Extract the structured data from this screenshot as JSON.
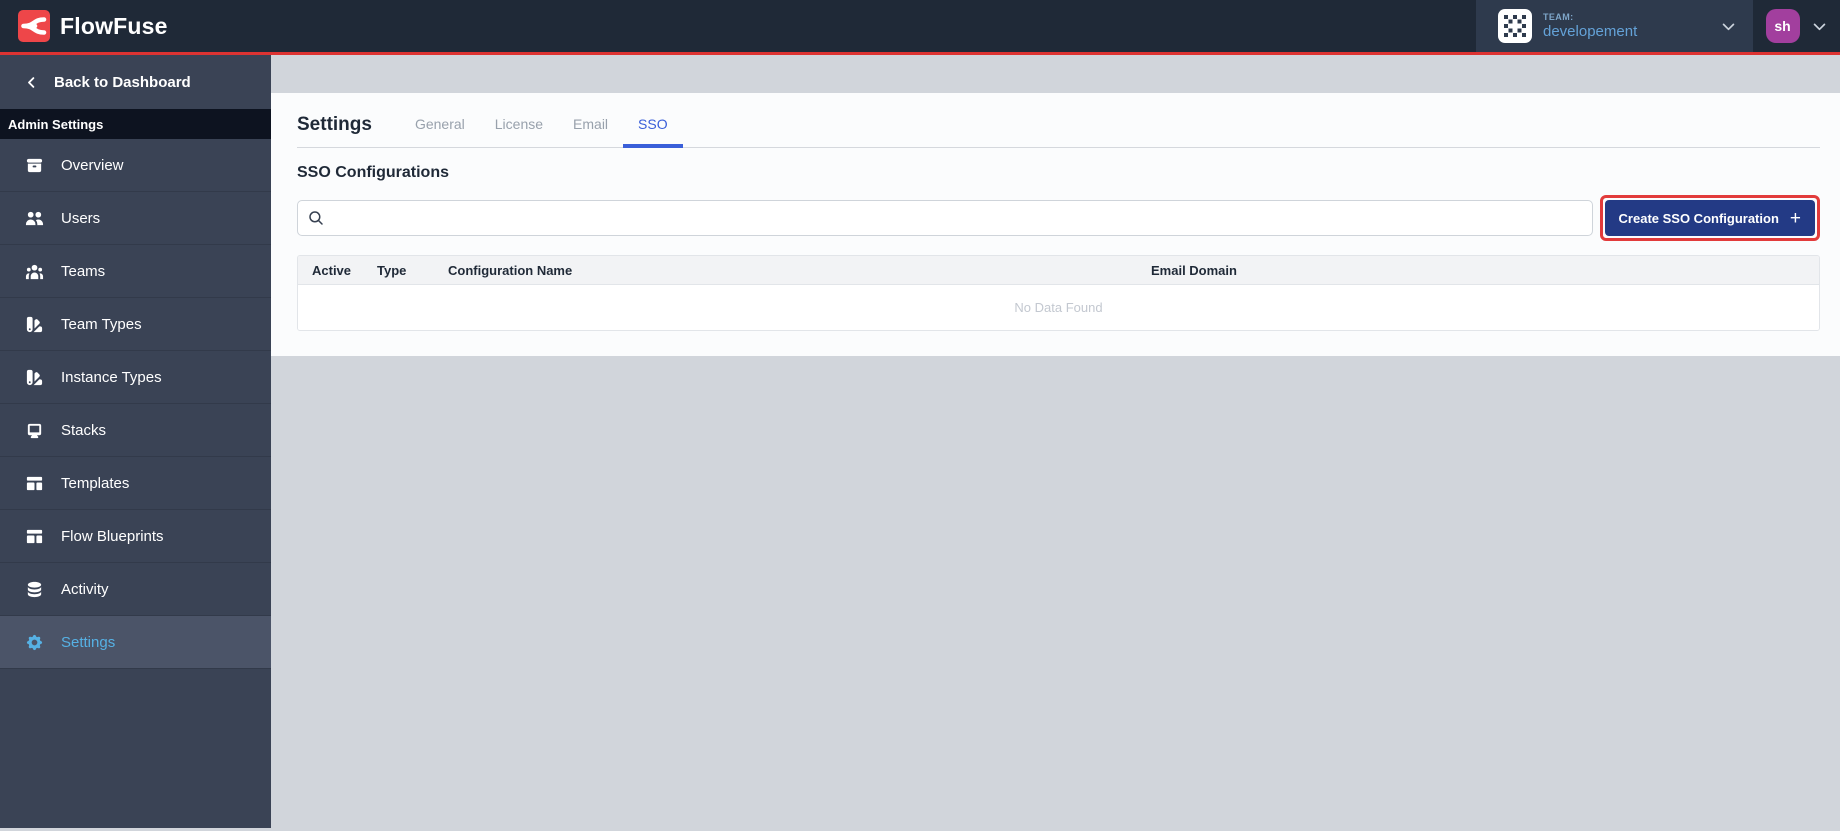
{
  "header": {
    "brand": "FlowFuse",
    "team": {
      "label": "TEAM:",
      "name": "developement"
    },
    "user_initials": "sh"
  },
  "sidebar": {
    "back_label": "Back to Dashboard",
    "section_label": "Admin Settings",
    "items": [
      {
        "label": "Overview",
        "icon": "overview-icon",
        "active": false
      },
      {
        "label": "Users",
        "icon": "users-icon",
        "active": false
      },
      {
        "label": "Teams",
        "icon": "teams-icon",
        "active": false
      },
      {
        "label": "Team Types",
        "icon": "team-types-icon",
        "active": false
      },
      {
        "label": "Instance Types",
        "icon": "instance-types-icon",
        "active": false
      },
      {
        "label": "Stacks",
        "icon": "stacks-icon",
        "active": false
      },
      {
        "label": "Templates",
        "icon": "templates-icon",
        "active": false
      },
      {
        "label": "Flow Blueprints",
        "icon": "blueprints-icon",
        "active": false
      },
      {
        "label": "Activity",
        "icon": "activity-icon",
        "active": false
      },
      {
        "label": "Settings",
        "icon": "settings-icon",
        "active": true
      }
    ]
  },
  "main": {
    "title": "Settings",
    "tabs": [
      {
        "label": "General",
        "active": false
      },
      {
        "label": "License",
        "active": false
      },
      {
        "label": "Email",
        "active": false
      },
      {
        "label": "SSO",
        "active": true
      }
    ],
    "section_title": "SSO Configurations",
    "search": {
      "value": "",
      "placeholder": ""
    },
    "create_button_label": "Create SSO Configuration",
    "table": {
      "columns": [
        "Active",
        "Type",
        "Configuration Name",
        "Email Domain"
      ],
      "empty_text": "No Data Found"
    }
  },
  "icons": {
    "plus": "+"
  },
  "colors": {
    "header_bg": "#1f2937",
    "brand_red": "#ee4649",
    "divider_red": "#dd3332",
    "sidebar_bg": "#3a4355",
    "sidebar_active_bg": "#4b5468",
    "sidebar_active_text": "#56b1e4",
    "tab_active_blue": "#3a5fd9",
    "button_navy": "#233a85",
    "annotation_red": "#e23b3b",
    "avatar_purple": "#a23f9e",
    "team_text_blue": "#64a2d8",
    "canvas_gray": "#d1d5db",
    "panel_bg": "#fbfcfd",
    "empty_text_gray": "#c3c8d0"
  }
}
